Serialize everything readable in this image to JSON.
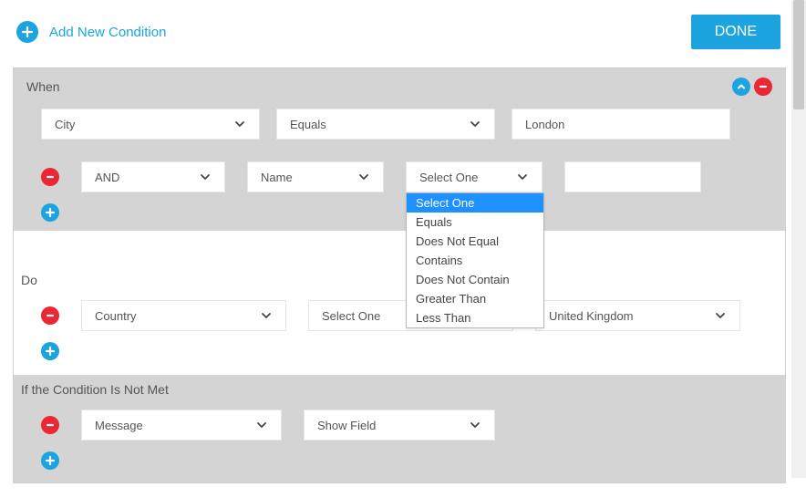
{
  "topbar": {
    "add_label": "Add New Condition",
    "done_label": "DONE"
  },
  "sections": {
    "when_title": "When",
    "do_title": "Do",
    "else_title": "If the Condition Is Not Met"
  },
  "when": {
    "row1_field": "City",
    "row1_op": "Equals",
    "row1_value": "London",
    "row2_logic": "AND",
    "row2_field": "Name",
    "row2_op": "Select One",
    "row2_value": ""
  },
  "do": {
    "row1_field": "Country",
    "row1_op": "Select One",
    "row1_value": "United Kingdom"
  },
  "else": {
    "row1_field": "Message",
    "row1_action": "Show Field"
  },
  "op_dropdown": {
    "options": [
      "Select One",
      "Equals",
      "Does Not Equal",
      "Contains",
      "Does Not Contain",
      "Greater Than",
      "Less Than"
    ],
    "selected": "Select One"
  }
}
